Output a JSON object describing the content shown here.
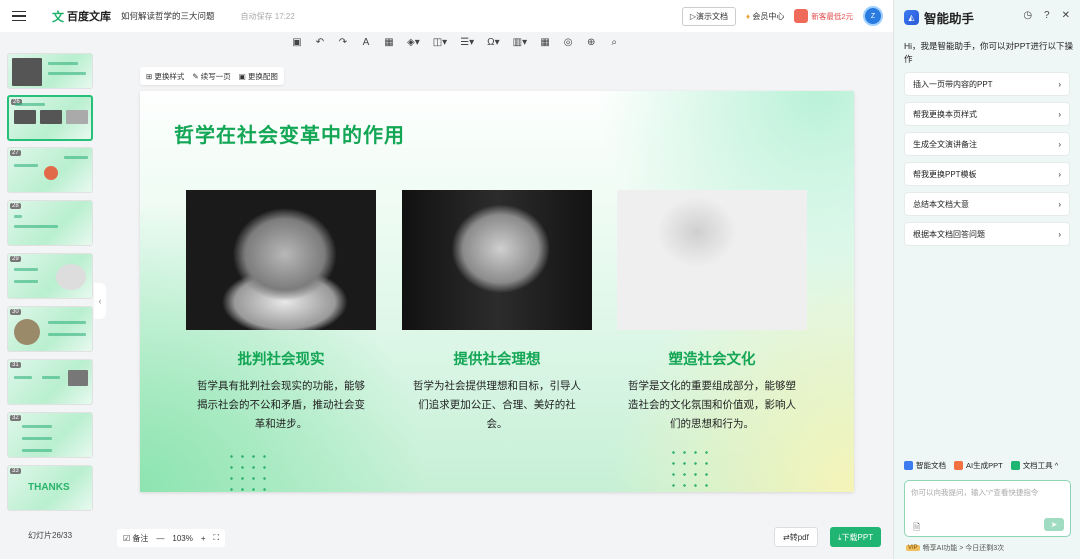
{
  "header": {
    "logo_icon": "文",
    "logo_text": "百度文库",
    "doc_title": "如何解读哲学的三大问题",
    "autosave": "自动保存 17:22",
    "demo_button": "▷演示文档",
    "vip_label": "会员中心",
    "promo_text": "新客最低2元",
    "avatar_text": "Z"
  },
  "toolbar": {
    "items": [
      "▣",
      "↶",
      "↷",
      "A",
      "▦",
      "◈▾",
      "◫▾",
      "☰▾",
      "Ω▾",
      "▥▾",
      "▦",
      "◎",
      "⊕",
      "⌕"
    ]
  },
  "thumbnails": {
    "numbers": [
      "",
      "26",
      "27",
      "28",
      "29",
      "30",
      "31",
      "32",
      "33"
    ],
    "thanks_text": "THANKS",
    "slide_counter": "幻灯片26/33"
  },
  "slide_tools": {
    "change_style": "更换样式",
    "continue_page": "续写一页",
    "change_image": "更换配图"
  },
  "slide": {
    "title": "哲学在社会变革中的作用",
    "columns": [
      {
        "heading": "批判社会现实",
        "text": "哲学具有批判社会现实的功能，能够揭示社会的不公和矛盾，推动社会变革和进步。"
      },
      {
        "heading": "提供社会理想",
        "text": "哲学为社会提供理想和目标，引导人们追求更加公正、合理、美好的社会。"
      },
      {
        "heading": "塑造社会文化",
        "text": "哲学是文化的重要组成部分，能够塑造社会的文化氛围和价值观，影响人们的思想和行为。"
      }
    ]
  },
  "bottom": {
    "notes": "备注",
    "minus": "—",
    "zoom": "103%",
    "plus": "+",
    "fit": "⛶",
    "to_pdf": "⇄转pdf",
    "download": "⤓下载PPT"
  },
  "assistant": {
    "title": "智能助手",
    "logo": "◭",
    "icons": [
      "◷",
      "?",
      "✕"
    ],
    "greeting": "Hi，我是智能助手，你可以对PPT进行以下操作",
    "suggestions": [
      "插入一页带内容的PPT",
      "帮我更换本页样式",
      "生成全文演讲备注",
      "帮我更换PPT模板",
      "总结本文档大意",
      "根据本文档回答问题"
    ],
    "chevron": "›",
    "tools": [
      "智能文档",
      "AI生成PPT",
      "文档工具 ^"
    ],
    "placeholder": "你可以向我提问，输入\"/\"查看快捷指令",
    "vip_badge": "VIP",
    "footer": "畅享AI功能 > 今日还剩3次"
  },
  "colors": {
    "accent_green": "#12a655",
    "button_green": "#21b573",
    "assistant_blue": "#3c7bf0"
  }
}
